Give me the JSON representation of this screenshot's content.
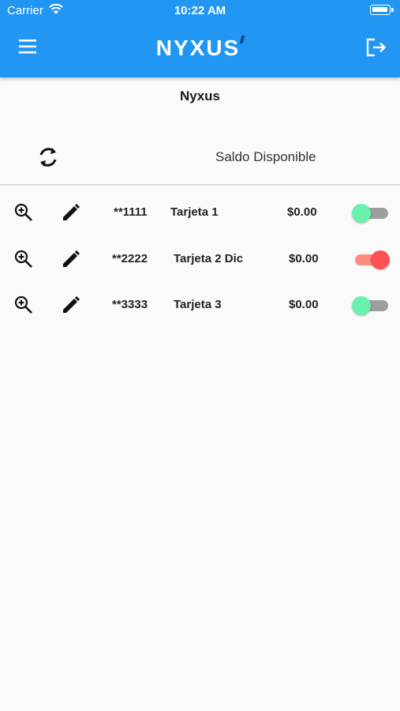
{
  "status_bar": {
    "carrier": "Carrier",
    "time": "10:22 AM"
  },
  "app_bar": {
    "logo": "NYXUS",
    "background_color": "#2196f3",
    "menu_icon": "hamburger-menu-icon",
    "logout_icon": "logout-icon"
  },
  "page": {
    "title": "Nyxus",
    "balance_label": "Saldo Disponible",
    "refresh_icon": "refresh-icon"
  },
  "cards": [
    {
      "number": "**1111",
      "name": "Tarjeta 1",
      "balance": "$0.00",
      "enabled": false
    },
    {
      "number": "**2222",
      "name": "Tarjeta 2 Dic",
      "balance": "$0.00",
      "enabled": true
    },
    {
      "number": "**3333",
      "name": "Tarjeta 3",
      "balance": "$0.00",
      "enabled": false
    }
  ],
  "colors": {
    "toggle_off_thumb": "#69f0ae",
    "toggle_on_thumb": "#ff5252"
  }
}
